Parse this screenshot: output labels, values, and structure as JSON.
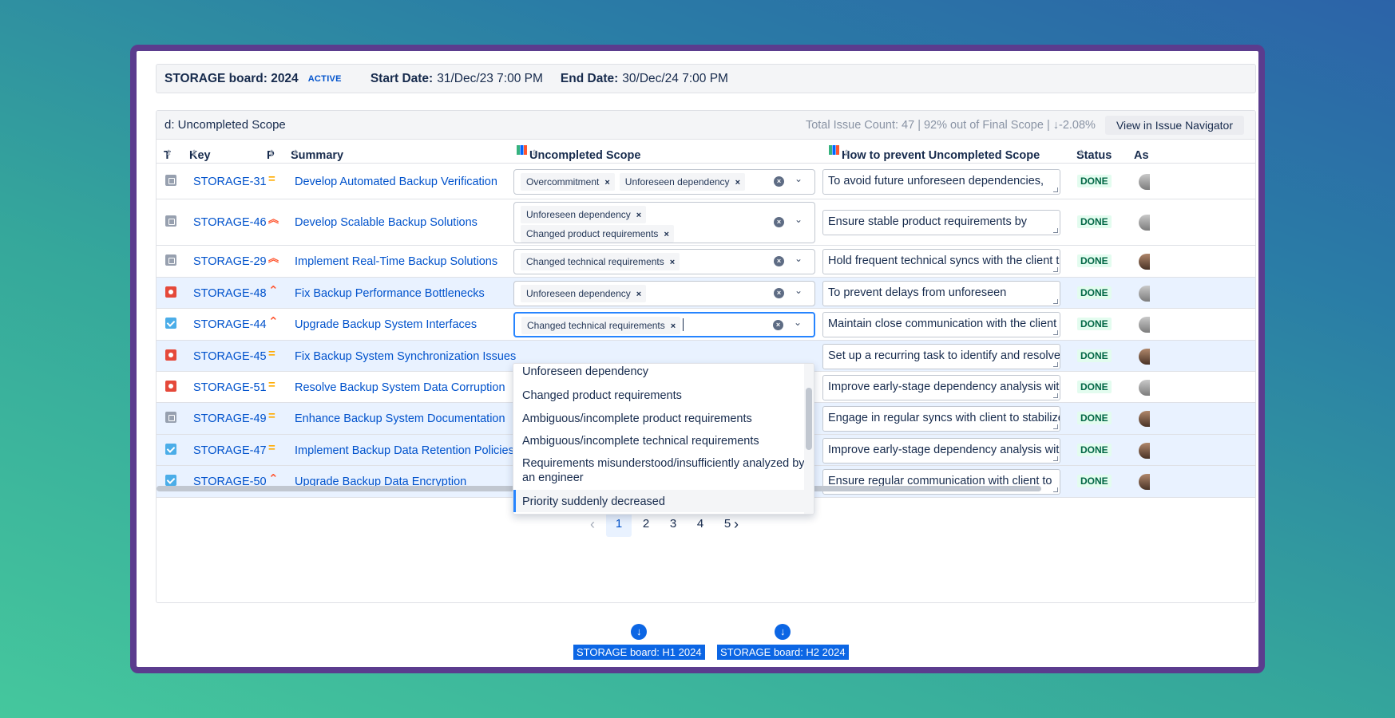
{
  "sprint": {
    "name": "STORAGE board: 2024",
    "badge": "ACTIVE",
    "start_label": "Start Date:",
    "start_value": "31/Dec/23 7:00 PM",
    "end_label": "End Date:",
    "end_value": "30/Dec/24 7:00 PM"
  },
  "panel": {
    "title": "d: Uncompleted Scope",
    "count_text": "Total Issue Count: 47 | 92% out of Final Scope | ↓-2.08%",
    "nav_button": "View in Issue Navigator"
  },
  "columns": {
    "type": "T",
    "key": "Key",
    "priority": "P",
    "summary": "Summary",
    "uncompleted": "Uncompleted Scope",
    "prevent": "How to prevent Uncompleted Scope",
    "status": "Status",
    "assignee": "As"
  },
  "rows": [
    {
      "type": "task",
      "key": "STORAGE-31",
      "priority": "medium",
      "summary": "Develop Automated Backup Verification",
      "tags": [
        "Overcommitment",
        "Unforeseen dependency"
      ],
      "prevent": "To avoid future unforeseen dependencies,",
      "status": "DONE"
    },
    {
      "type": "task",
      "key": "STORAGE-46",
      "priority": "highest",
      "summary": "Develop Scalable Backup Solutions",
      "tags": [
        "Unforeseen dependency",
        "Changed product requirements"
      ],
      "prevent": "Ensure stable product requirements by",
      "status": "DONE"
    },
    {
      "type": "task",
      "key": "STORAGE-29",
      "priority": "highest",
      "summary": "Implement Real-Time Backup Solutions",
      "tags": [
        "Changed technical requirements"
      ],
      "prevent": "Hold frequent technical syncs with the client to",
      "status": "DONE"
    },
    {
      "type": "bug",
      "key": "STORAGE-48",
      "priority": "high",
      "summary": "Fix Backup Performance Bottlenecks",
      "tags": [
        "Unforeseen dependency"
      ],
      "prevent": "To prevent delays from unforeseen",
      "status": "DONE"
    },
    {
      "type": "story",
      "key": "STORAGE-44",
      "priority": "high",
      "summary": "Upgrade Backup System Interfaces",
      "tags": [
        "Changed technical requirements"
      ],
      "prevent": "Maintain close communication with the client",
      "status": "DONE"
    },
    {
      "type": "bug",
      "key": "STORAGE-45",
      "priority": "medium",
      "summary": "Fix Backup System Synchronization Issues",
      "tags": [],
      "prevent": "Set up a recurring task to identify and resolve",
      "status": "DONE"
    },
    {
      "type": "bug",
      "key": "STORAGE-51",
      "priority": "medium",
      "summary": "Resolve Backup System Data Corruption",
      "tags": [],
      "prevent": "Improve early-stage dependency analysis with",
      "status": "DONE"
    },
    {
      "type": "task",
      "key": "STORAGE-49",
      "priority": "medium",
      "summary": "Enhance Backup System Documentation",
      "tags": [],
      "prevent": "Engage in regular syncs with client to stabilize",
      "status": "DONE"
    },
    {
      "type": "story",
      "key": "STORAGE-47",
      "priority": "medium",
      "summary": "Implement Backup Data Retention Policies",
      "tags": [],
      "prevent": "Improve early-stage dependency analysis with",
      "status": "DONE"
    },
    {
      "type": "story",
      "key": "STORAGE-50",
      "priority": "high",
      "summary": "Upgrade Backup Data Encryption",
      "tags": [],
      "prevent": "Ensure regular communication with client to",
      "status": "DONE"
    }
  ],
  "dropdown_options": [
    "Unforeseen dependency",
    "Changed product requirements",
    "Ambiguous/incomplete product requirements",
    "Ambiguous/incomplete technical requirements",
    "Requirements misunderstood/insufficiently analyzed by an engineer",
    "Priority suddenly decreased"
  ],
  "dropdown_selected_index": 5,
  "pagination": {
    "pages": [
      "1",
      "2",
      "3",
      "4",
      "5"
    ],
    "current": "1",
    "prev": "‹",
    "next": "›"
  },
  "boards": [
    "STORAGE board: H1 2024",
    "STORAGE board: H2 2024"
  ],
  "icons": {
    "clear": "×",
    "chevron": "⌄",
    "download": "↓"
  },
  "colors": {
    "frame": "#5b3c8e",
    "link": "#0052cc",
    "done": "#006644",
    "highlight": "#e9f2ff"
  }
}
